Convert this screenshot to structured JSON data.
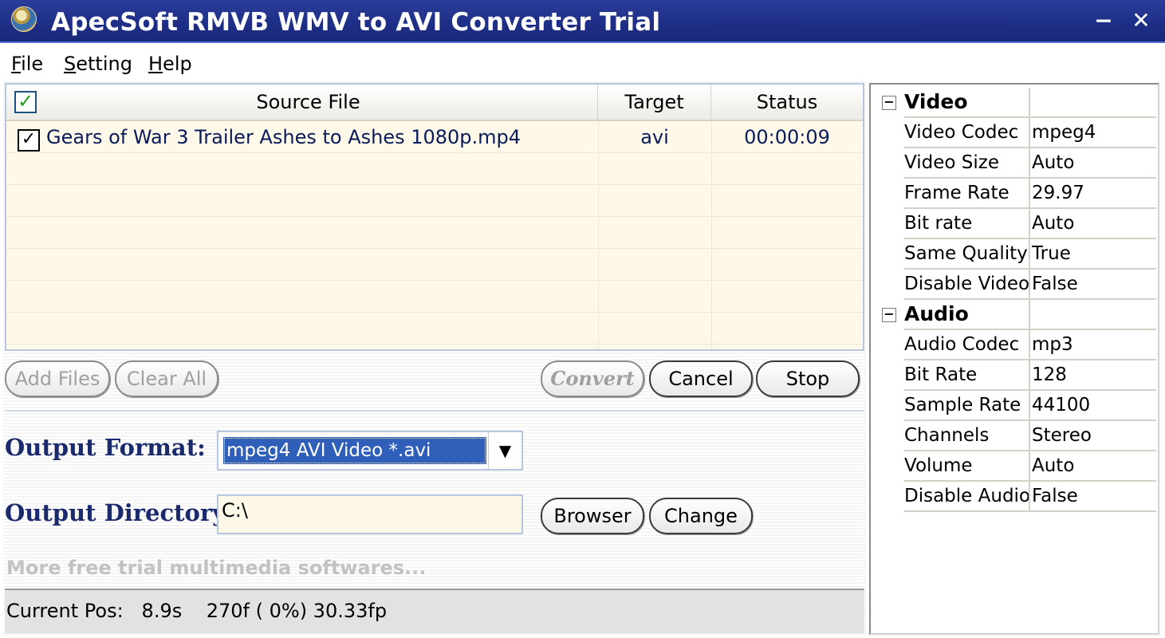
{
  "window": {
    "title": "ApecSoft RMVB WMV to AVI Converter Trial",
    "minimize_glyph": "−",
    "close_glyph": "✕"
  },
  "menu": {
    "items": [
      {
        "label_ul": "F",
        "label_rest": "ile"
      },
      {
        "label_ul": "S",
        "label_rest": "etting"
      },
      {
        "label_ul": "H",
        "label_rest": "elp"
      }
    ]
  },
  "file_list": {
    "columns": [
      "Source File",
      "Target",
      "Status"
    ],
    "header_check_glyph": "✓",
    "rows": [
      {
        "checked_glyph": "✓",
        "source": "Gears of War 3 Trailer Ashes to Ashes 1080p.mp4",
        "target": "avi",
        "status": "00:00:09"
      }
    ]
  },
  "buttons": {
    "add_files": "Add Files",
    "clear_all": "Clear All",
    "convert": "Convert",
    "cancel": "Cancel",
    "stop": "Stop",
    "browser": "Browser",
    "change": "Change"
  },
  "output": {
    "format_label": "Output Format:",
    "format_value": "mpeg4 AVI Video *.avi",
    "dropdown_glyph": "▼",
    "directory_label": "Output Directory:",
    "directory_value": "C:\\"
  },
  "more_link": "More free trial multimedia softwares...",
  "status": {
    "text": "Current Pos:   8.9s    270f ( 0%) 30.33fp"
  },
  "properties": {
    "video": {
      "category": "Video",
      "collapse_glyph": "−",
      "rows": [
        {
          "key": "Video Codec",
          "value": "mpeg4"
        },
        {
          "key": "Video Size",
          "value": "Auto"
        },
        {
          "key": "Frame Rate",
          "value": "29.97"
        },
        {
          "key": "Bit rate",
          "value": "Auto"
        },
        {
          "key": "Same Quality",
          "value": "True"
        },
        {
          "key": "Disable Video",
          "value": "False"
        }
      ]
    },
    "audio": {
      "category": "Audio",
      "collapse_glyph": "−",
      "rows": [
        {
          "key": "Audio Codec",
          "value": "mp3"
        },
        {
          "key": "Bit Rate",
          "value": "128"
        },
        {
          "key": "Sample Rate",
          "value": "44100"
        },
        {
          "key": "Channels",
          "value": "Stereo"
        },
        {
          "key": "Volume",
          "value": "Auto"
        },
        {
          "key": "Disable Audio",
          "value": "False"
        }
      ]
    }
  }
}
